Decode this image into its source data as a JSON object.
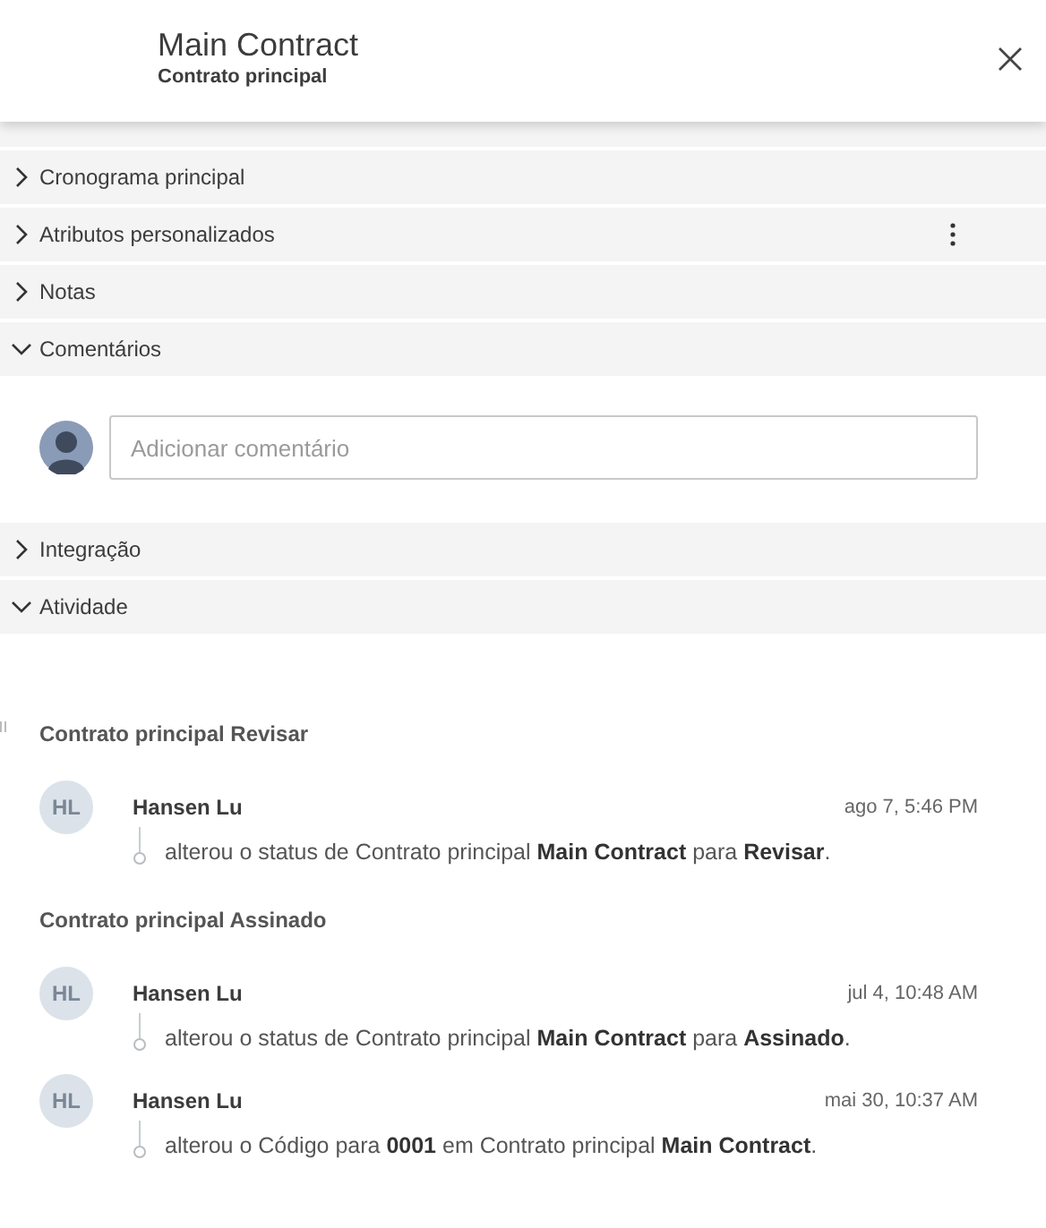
{
  "header": {
    "title": "Main Contract",
    "subtitle": "Contrato principal"
  },
  "sections": [
    {
      "label": "Cronograma principal",
      "expanded": false
    },
    {
      "label": "Atributos personalizados",
      "expanded": false,
      "has_menu": true
    },
    {
      "label": "Notas",
      "expanded": false
    },
    {
      "label": "Comentários",
      "expanded": true,
      "kind": "comments",
      "placeholder": "Adicionar comentário"
    },
    {
      "label": "Integração",
      "expanded": false
    },
    {
      "label": "Atividade",
      "expanded": true,
      "kind": "activity",
      "groups": [
        {
          "title": "Contrato principal Revisar",
          "entries": [
            {
              "initials": "HL",
              "name": "Hansen Lu",
              "time": "ago 7, 5:46 PM",
              "text": "alterou o status de Contrato principal **Main Contract** para **Revisar**."
            }
          ]
        },
        {
          "title": "Contrato principal Assinado",
          "entries": [
            {
              "initials": "HL",
              "name": "Hansen Lu",
              "time": "jul 4, 10:48 AM",
              "text": "alterou o status de Contrato principal **Main Contract** para **Assinado**."
            },
            {
              "initials": "HL",
              "name": "Hansen Lu",
              "time": "mai 30, 10:37 AM",
              "text": "alterou o Código para **0001** em Contrato principal **Main Contract**."
            }
          ]
        }
      ]
    }
  ]
}
